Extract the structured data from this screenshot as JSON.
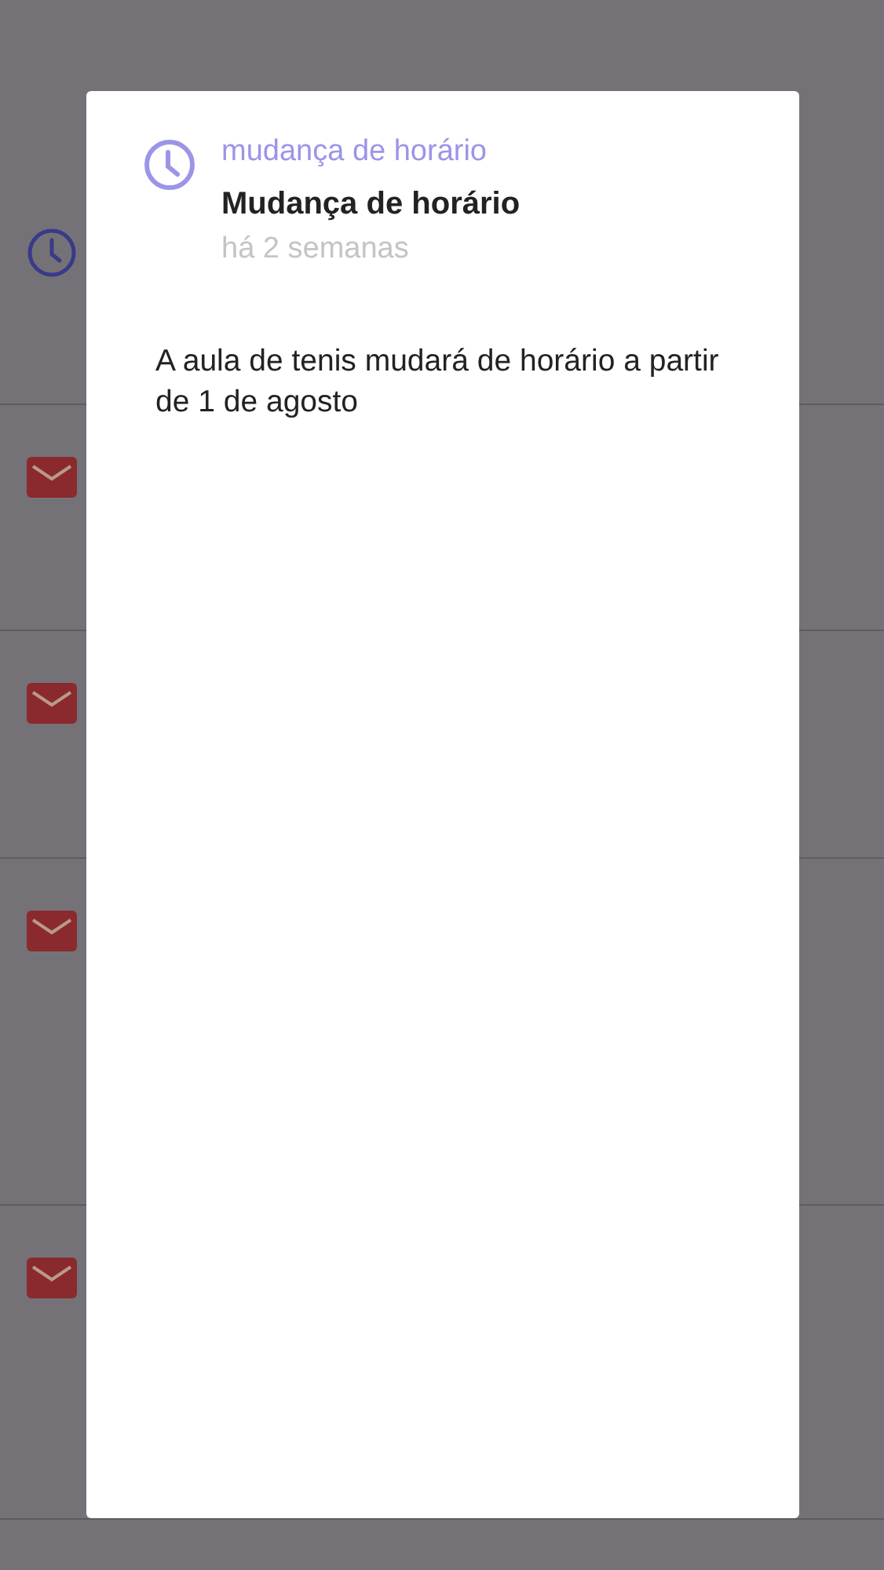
{
  "background_list": [
    {
      "kind": "clock"
    },
    {
      "kind": "mail"
    },
    {
      "kind": "mail"
    },
    {
      "kind": "mail"
    },
    {
      "kind": "mail"
    }
  ],
  "modal": {
    "category": "mudança de horário",
    "title": "Mudança de horário",
    "time": "há 2 semanas",
    "body": "A aula de tenis mudará de horário a partir de 1 de agosto"
  }
}
